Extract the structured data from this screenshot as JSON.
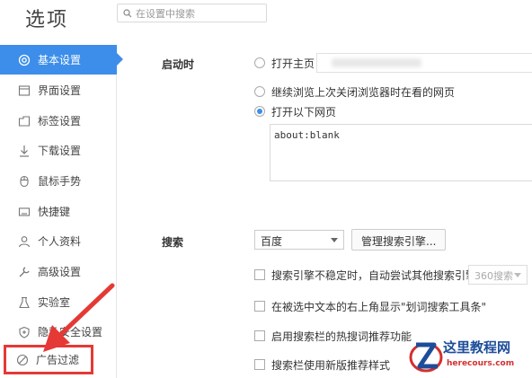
{
  "header": {
    "title": "选项",
    "search_placeholder": "在设置中搜索"
  },
  "sidebar": {
    "items": [
      {
        "label": "基本设置",
        "icon": "gear-icon",
        "active": true
      },
      {
        "label": "界面设置",
        "icon": "window-icon"
      },
      {
        "label": "标签设置",
        "icon": "tab-icon"
      },
      {
        "label": "下载设置",
        "icon": "download-icon"
      },
      {
        "label": "鼠标手势",
        "icon": "mouse-icon"
      },
      {
        "label": "快捷键",
        "icon": "keyboard-icon"
      },
      {
        "label": "个人资料",
        "icon": "user-icon"
      },
      {
        "label": "高级设置",
        "icon": "wrench-icon"
      },
      {
        "label": "实验室",
        "icon": "flask-icon"
      },
      {
        "label": "隐私安全设置",
        "icon": "shield-icon"
      },
      {
        "label": "广告过滤",
        "icon": "block-icon",
        "highlighted": true
      }
    ]
  },
  "startup": {
    "label": "启动时",
    "options": [
      {
        "label": "打开主页",
        "checked": false
      },
      {
        "label": "继续浏览上次关闭浏览器时在看的网页",
        "checked": false
      },
      {
        "label": "打开以下网页",
        "checked": true
      }
    ],
    "pages_value": "about:blank"
  },
  "search": {
    "label": "搜索",
    "engine": "百度",
    "manage_button": "管理搜索引擎...",
    "checkboxes": [
      {
        "label": "搜索引擎不稳定时，自动尝试其他搜索引擎:",
        "checked": false
      },
      {
        "label": "在被选中文本的右上角显示\"划词搜索工具条\"",
        "checked": false
      },
      {
        "label": "启用搜索栏的热搜词推荐功能",
        "checked": false
      },
      {
        "label": "搜索栏使用新版推荐样式",
        "checked": false
      }
    ],
    "fallback_engine": "360搜索"
  },
  "watermark": {
    "name": "这里教程网",
    "url": "herecours.com"
  },
  "colors": {
    "accent": "#3d8eea",
    "annotation": "#e53935"
  }
}
